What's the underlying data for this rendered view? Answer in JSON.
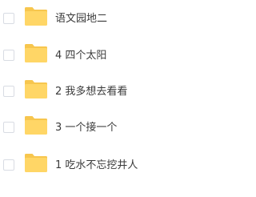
{
  "folder_color": "#ffd666",
  "folder_tab_color": "#f7c64e",
  "files": [
    {
      "name": "语文园地二",
      "icon": "folder-icon",
      "selected": false
    },
    {
      "name": "4 四个太阳",
      "icon": "folder-icon",
      "selected": false
    },
    {
      "name": "2 我多想去看看",
      "icon": "folder-icon",
      "selected": false
    },
    {
      "name": "3 一个接一个",
      "icon": "folder-icon",
      "selected": false
    },
    {
      "name": "1 吃水不忘挖井人",
      "icon": "folder-icon",
      "selected": false
    }
  ]
}
